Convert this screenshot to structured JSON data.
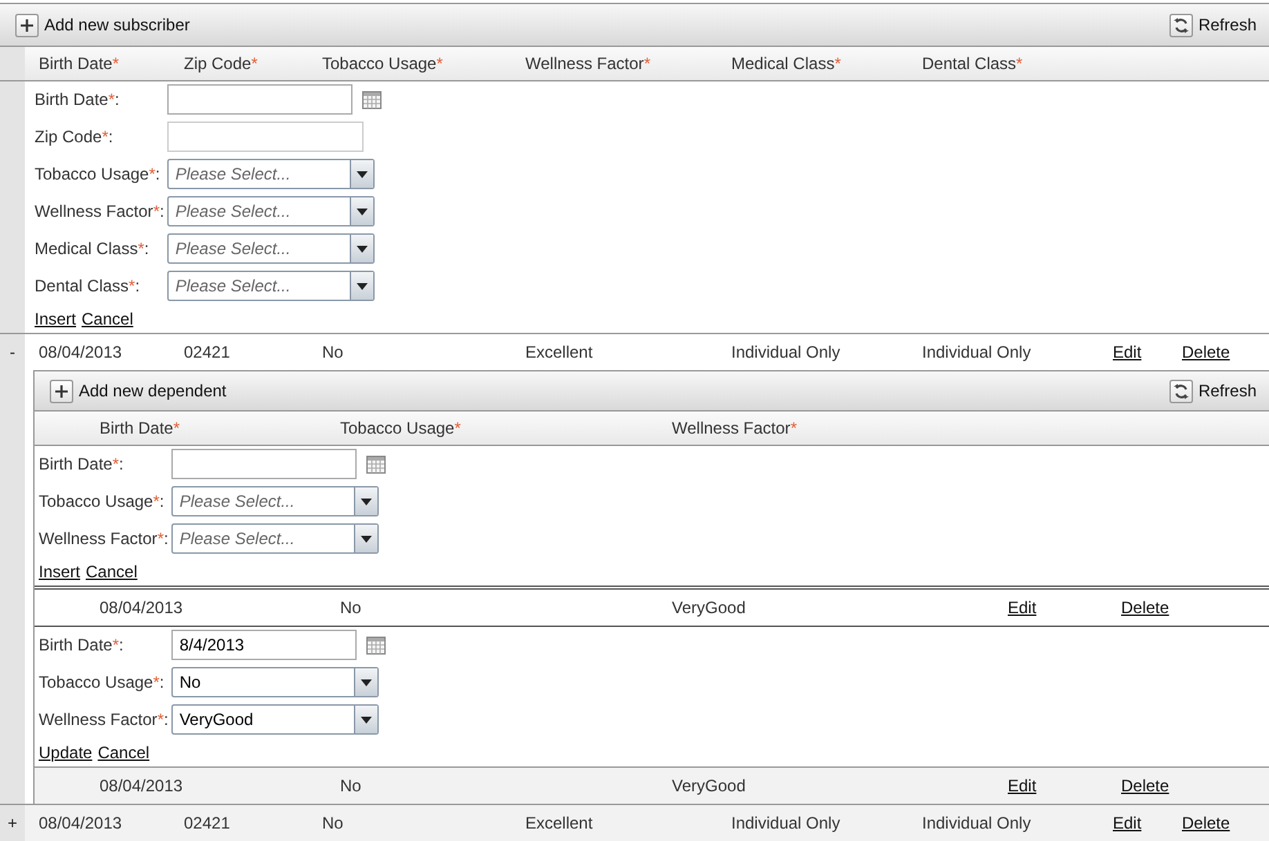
{
  "toolbar": {
    "add_label": "Add new subscriber",
    "refresh_label": "Refresh"
  },
  "columns": [
    {
      "label": "Birth Date",
      "mark": "*"
    },
    {
      "label": "Zip Code",
      "mark": "*"
    },
    {
      "label": "Tobacco Usage",
      "mark": "*"
    },
    {
      "label": "Wellness Factor",
      "mark": "*"
    },
    {
      "label": "Medical Class",
      "mark": "*"
    },
    {
      "label": "Dental Class",
      "mark": "*"
    }
  ],
  "insert_form": {
    "fields": [
      {
        "label": "Birth Date",
        "mark": "*",
        "suffix": ":",
        "kind": "date"
      },
      {
        "label": "Zip Code",
        "mark": "*",
        "suffix": ":",
        "kind": "text"
      },
      {
        "label": "Tobacco Usage",
        "mark": "*",
        "suffix": ":",
        "kind": "select",
        "placeholder": "Please Select..."
      },
      {
        "label": "Wellness Factor",
        "mark": "*",
        "suffix": ":",
        "kind": "select",
        "placeholder": "Please Select..."
      },
      {
        "label": "Medical Class",
        "mark": "*",
        "suffix": ":",
        "kind": "select",
        "placeholder": "Please Select..."
      },
      {
        "label": "Dental Class",
        "mark": "*",
        "suffix": ":",
        "kind": "select",
        "placeholder": "Please Select..."
      }
    ],
    "actions": [
      "Insert",
      "Cancel"
    ]
  },
  "rows": [
    {
      "toggle": "-",
      "expanded": true,
      "cells": [
        "08/04/2013",
        "02421",
        "No",
        "Excellent",
        "Individual Only",
        "Individual Only"
      ],
      "actions": [
        "Edit",
        "Delete"
      ],
      "detail": {
        "toolbar": {
          "add_label": "Add new dependent",
          "refresh_label": "Refresh"
        },
        "columns": [
          {
            "label": "Birth Date",
            "mark": "*"
          },
          {
            "label": "Tobacco Usage",
            "mark": "*"
          },
          {
            "label": "Wellness Factor",
            "mark": "*"
          }
        ],
        "insert_form": {
          "fields": [
            {
              "label": "Birth Date",
              "mark": "*",
              "suffix": ":",
              "kind": "date"
            },
            {
              "label": "Tobacco Usage",
              "mark": "*",
              "suffix": ":",
              "kind": "select",
              "placeholder": "Please Select..."
            },
            {
              "label": "Wellness Factor",
              "mark": "*",
              "suffix": ":",
              "kind": "select",
              "placeholder": "Please Select..."
            }
          ],
          "actions": [
            "Insert",
            "Cancel"
          ]
        },
        "rows": [
          {
            "cells": [
              "08/04/2013",
              "No",
              "VeryGood"
            ],
            "actions": [
              "Edit",
              "Delete"
            ],
            "editing": true,
            "edit_form": {
              "fields": [
                {
                  "label": "Birth Date",
                  "mark": "*",
                  "suffix": ":",
                  "kind": "date",
                  "value": "8/4/2013"
                },
                {
                  "label": "Tobacco Usage",
                  "mark": "*",
                  "suffix": ":",
                  "kind": "select",
                  "value": "No"
                },
                {
                  "label": "Wellness Factor",
                  "mark": "*",
                  "suffix": ":",
                  "kind": "select",
                  "value": "VeryGood"
                }
              ],
              "actions": [
                "Update",
                "Cancel"
              ]
            }
          },
          {
            "cells": [
              "08/04/2013",
              "No",
              "VeryGood"
            ],
            "actions": [
              "Edit",
              "Delete"
            ],
            "editing": false
          }
        ]
      }
    },
    {
      "toggle": "+",
      "expanded": false,
      "cells": [
        "08/04/2013",
        "02421",
        "No",
        "Excellent",
        "Individual Only",
        "Individual Only"
      ],
      "actions": [
        "Edit",
        "Delete"
      ]
    }
  ]
}
